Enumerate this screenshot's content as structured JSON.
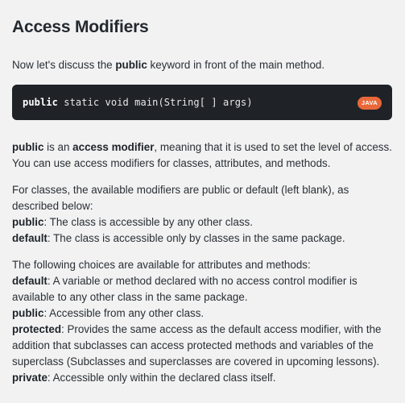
{
  "lesson": {
    "title": "Access Modifiers",
    "intro": {
      "before": "Now let's discuss the ",
      "bold": "public",
      "after": " keyword in front of the main method."
    },
    "code": {
      "keyword": "public",
      "rest": " static void main(String[ ] args)",
      "language_badge": "JAVA"
    },
    "para1": {
      "b1": "public",
      "t1": " is an ",
      "b2": "access modifier",
      "t2": ", meaning that it is used to set the level of access. You can use access modifiers for classes, attributes, and methods."
    },
    "para2": {
      "lead": "For classes, the available modifiers are public or default (left blank), as described below:",
      "items": [
        {
          "term": "public",
          "desc": ": The class is accessible by any other class."
        },
        {
          "term": "default",
          "desc": ": The class is accessible only by classes in the same package."
        }
      ]
    },
    "para3": {
      "lead": "The following choices are available for attributes and methods:",
      "items": [
        {
          "term": "default",
          "desc": ": A variable or method declared with no access control modifier is available to any other class in the same package."
        },
        {
          "term": "public",
          "desc": ": Accessible from any other class."
        },
        {
          "term": "protected",
          "desc": ": Provides the same access as the default access modifier, with the addition that subclasses can access protected methods and variables of the superclass (Subclasses and superclasses are covered in upcoming lessons)."
        },
        {
          "term": "private",
          "desc": ": Accessible only within the declared class itself."
        }
      ]
    }
  },
  "colors": {
    "background": "#f2f2f2",
    "code_background": "#1f2227",
    "badge": "#e8683a",
    "text": "#2a2f35"
  }
}
